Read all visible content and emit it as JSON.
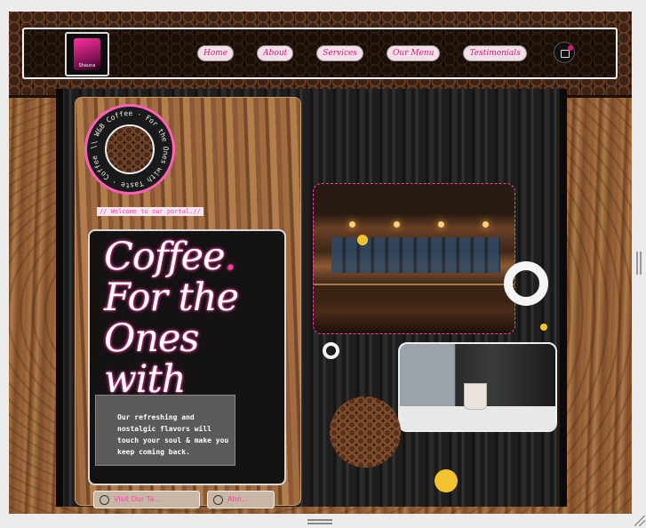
{
  "nav": {
    "logo_text": "Shauna",
    "items": [
      {
        "label": "Home"
      },
      {
        "label": "About"
      },
      {
        "label": "Services"
      },
      {
        "label": "Our Menu"
      },
      {
        "label": "Testimonials"
      }
    ]
  },
  "badge": {
    "ring_text": "\\\\ W&B Coffee · For the Ones with Taste · Coffee Delivered // "
  },
  "hero": {
    "welcome": "// Welcome to our portal.//",
    "headline_1": "Coffee",
    "headline_2": " For the Ones with Taste",
    "tagline": "Our refreshing and nostalgic flavors will touch your soul & make you keep coming back.",
    "cta_primary": "Visit Our Ta...",
    "cta_secondary": "Abo..."
  },
  "colors": {
    "accent": "#ff3ea6",
    "yellow": "#f2c230",
    "headline_text": "#ffffff"
  },
  "icons": {
    "cart": "shopping-bag-icon",
    "cta_primary": "coffee-icon",
    "cta_secondary": "info-icon"
  }
}
